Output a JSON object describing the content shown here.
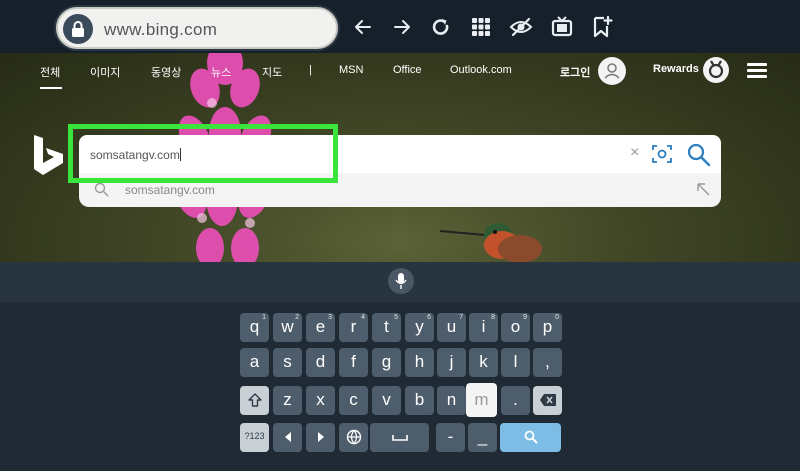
{
  "browser": {
    "url": "www.bing.com",
    "toolbar_icons": [
      "back-arrow-icon",
      "forward-arrow-icon",
      "refresh-icon",
      "apps-grid-icon",
      "hide-eye-icon",
      "tv-icon",
      "bookmark-add-icon"
    ]
  },
  "bing": {
    "nav": [
      "전체",
      "이미지",
      "동영상",
      "뉴스",
      "지도",
      "|",
      "MSN",
      "Office",
      "Outlook.com"
    ],
    "login": "로그인",
    "rewards": "Rewards",
    "search_value": "somsatangv.com",
    "suggestion": "somsatangv.com",
    "clear": "×"
  },
  "keyboard": {
    "row1": [
      {
        "k": "q",
        "n": "1"
      },
      {
        "k": "w",
        "n": "2"
      },
      {
        "k": "e",
        "n": "3"
      },
      {
        "k": "r",
        "n": "4"
      },
      {
        "k": "t",
        "n": "5"
      },
      {
        "k": "y",
        "n": "6"
      },
      {
        "k": "u",
        "n": "7"
      },
      {
        "k": "i",
        "n": "8"
      },
      {
        "k": "o",
        "n": "9"
      },
      {
        "k": "p",
        "n": "0"
      }
    ],
    "row2": [
      "a",
      "s",
      "d",
      "f",
      "g",
      "h",
      "j",
      "k",
      "l",
      ","
    ],
    "row3": [
      "z",
      "x",
      "c",
      "v",
      "b",
      "n",
      "m",
      "."
    ],
    "symbols": "?123",
    "dash": "-",
    "underscore": "_"
  },
  "colors": {
    "highlight": "#39e53a",
    "search_accent": "#2a7ec0",
    "key": "#4e5d6b",
    "key_action": "#7dbde5"
  }
}
